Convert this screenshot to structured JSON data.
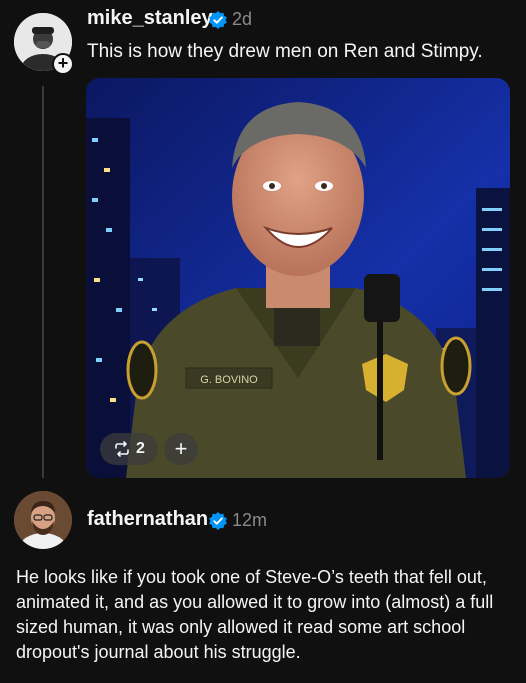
{
  "post": {
    "username": "mike_stanley",
    "verified": true,
    "timestamp": "2d",
    "text": "This is how they drew men on Ren and Stimpy.",
    "follow_symbol": "+",
    "image": {
      "name_tag": "G. BOVINO"
    },
    "actions": {
      "repost_count": "2",
      "add_symbol": "+"
    }
  },
  "reply": {
    "username": "fathernathan",
    "verified": true,
    "timestamp": "12m",
    "text": "He looks like if you took one of Steve-O’s teeth that fell out, animated it, and as you allowed it to grow into (almost) a full sized human, it was only allowed it read some art school dropout's journal about his struggle."
  },
  "colors": {
    "background": "#101010",
    "text": "#f3f5f7",
    "secondary_text": "#8a8a8a",
    "verified_blue": "#0095f6"
  }
}
